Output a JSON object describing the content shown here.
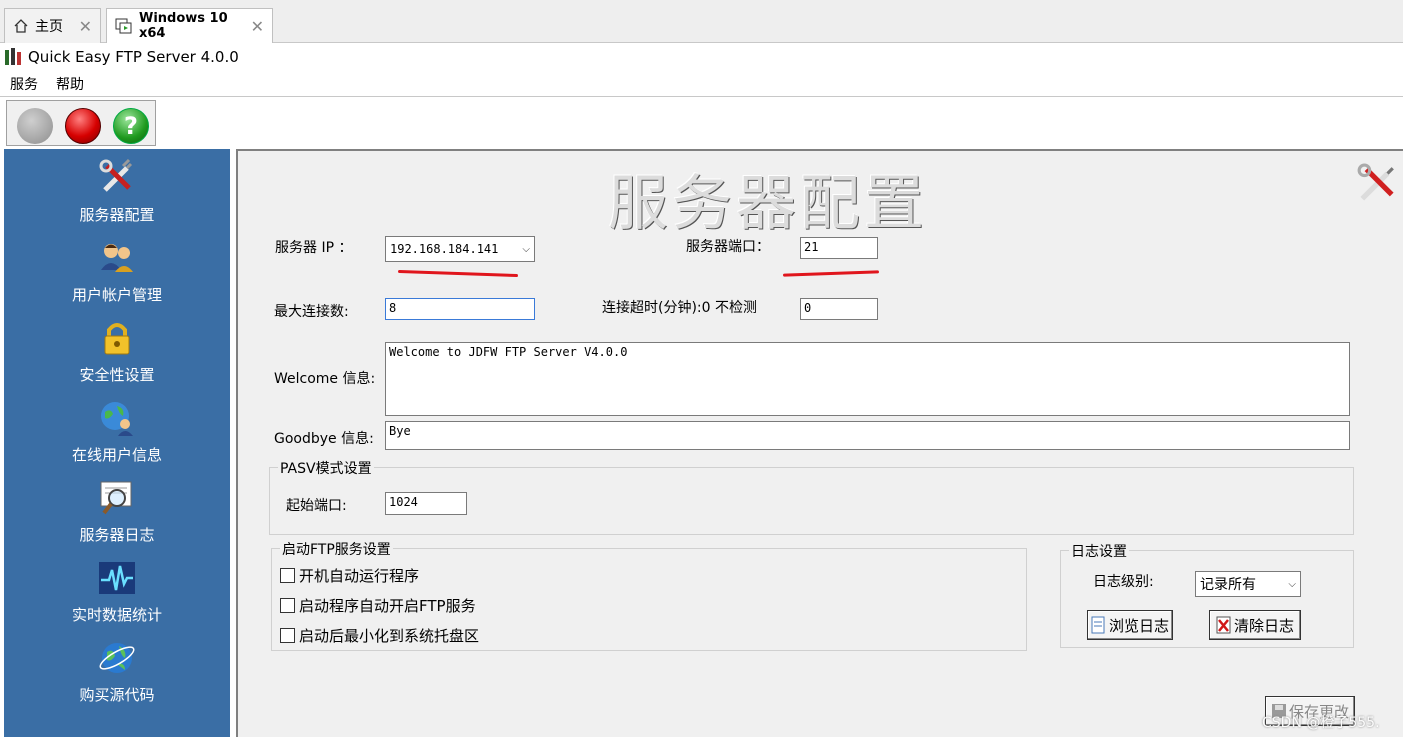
{
  "tabs": [
    {
      "label": "主页"
    },
    {
      "label": "Windows 10 x64"
    }
  ],
  "window": {
    "title": "Quick Easy FTP Server 4.0.0"
  },
  "menu": [
    "服务",
    "帮助"
  ],
  "sidebar": {
    "items": [
      {
        "label": "服务器配置",
        "icon": "tools-icon"
      },
      {
        "label": "用户帐户管理",
        "icon": "users-icon"
      },
      {
        "label": "安全性设置",
        "icon": "lock-icon"
      },
      {
        "label": "在线用户信息",
        "icon": "globe-user-icon"
      },
      {
        "label": "服务器日志",
        "icon": "log-magnifier-icon"
      },
      {
        "label": "实时数据统计",
        "icon": "pulse-chart-icon"
      },
      {
        "label": "购买源代码",
        "icon": "globe-icon"
      }
    ]
  },
  "config": {
    "heading": "服务器配置",
    "server_ip_label": "服务器 IP ：",
    "server_ip_value": "192.168.184.141",
    "server_port_label": "服务器端口：",
    "server_port_value": "21",
    "max_conn_label": "最大连接数:",
    "max_conn_value": "8",
    "timeout_label": "连接超时(分钟):0 不检测",
    "timeout_value": "0",
    "welcome_label": "Welcome 信息:",
    "welcome_value": "Welcome to JDFW  FTP Server V4.0.0",
    "goodbye_label": "Goodbye 信息:",
    "goodbye_value": "Bye",
    "pasv_legend": "PASV模式设置",
    "pasv_start_label": "起始端口:",
    "pasv_start_value": "1024",
    "startup_legend": "启动FTP服务设置",
    "startup_options": [
      {
        "label": "开机自动运行程序",
        "checked": false
      },
      {
        "label": "启动程序自动开启FTP服务",
        "checked": false
      },
      {
        "label": "启动后最小化到系统托盘区",
        "checked": false
      }
    ],
    "log_legend": "日志设置",
    "log_level_label": "日志级别:",
    "log_level_value": "记录所有",
    "browse_log_label": "浏览日志",
    "clear_log_label": "清除日志",
    "save_label": "保存更改"
  },
  "watermark": "CSDN @橙子555.",
  "colors": {
    "sidebar_bg": "#3a6ea5",
    "panel_bg": "#f0f0f0",
    "annotation_red": "#e0161d"
  }
}
